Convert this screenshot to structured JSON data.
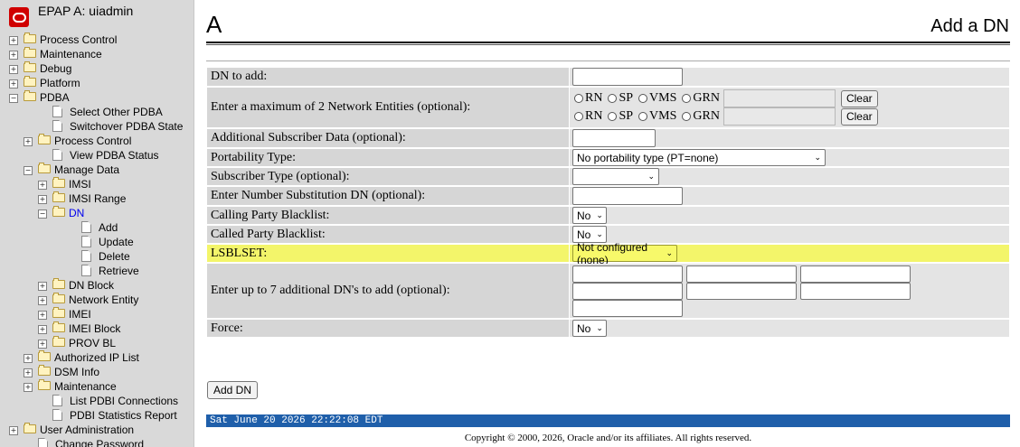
{
  "app": {
    "title": "EPAP A: uiadmin"
  },
  "sidebar": {
    "items": [
      {
        "label": "Process Control",
        "type": "folder",
        "toggle": "+",
        "open": false,
        "level": 0,
        "active": false
      },
      {
        "label": "Maintenance",
        "type": "folder",
        "toggle": "+",
        "open": false,
        "level": 0,
        "active": false
      },
      {
        "label": "Debug",
        "type": "folder",
        "toggle": "+",
        "open": false,
        "level": 0,
        "active": false
      },
      {
        "label": "Platform",
        "type": "folder",
        "toggle": "+",
        "open": false,
        "level": 0,
        "active": false
      },
      {
        "label": "PDBA",
        "type": "folder",
        "toggle": "−",
        "open": true,
        "level": 0,
        "active": false
      },
      {
        "label": "Select Other PDBA",
        "type": "doc",
        "toggle": "",
        "open": false,
        "level": 1,
        "active": false
      },
      {
        "label": "Switchover PDBA State",
        "type": "doc",
        "toggle": "",
        "open": false,
        "level": 1,
        "active": false
      },
      {
        "label": "Process Control",
        "type": "folder",
        "toggle": "+",
        "open": false,
        "level": 1,
        "active": false
      },
      {
        "label": "View PDBA Status",
        "type": "doc",
        "toggle": "",
        "open": false,
        "level": 1,
        "active": false
      },
      {
        "label": "Manage Data",
        "type": "folder",
        "toggle": "−",
        "open": true,
        "level": 1,
        "active": false
      },
      {
        "label": "IMSI",
        "type": "folder",
        "toggle": "+",
        "open": false,
        "level": 2,
        "active": false
      },
      {
        "label": "IMSI Range",
        "type": "folder",
        "toggle": "+",
        "open": false,
        "level": 2,
        "active": false
      },
      {
        "label": "DN",
        "type": "folder",
        "toggle": "−",
        "open": true,
        "level": 2,
        "active": true
      },
      {
        "label": "Add",
        "type": "doc",
        "toggle": "",
        "open": false,
        "level": 3,
        "active": false
      },
      {
        "label": "Update",
        "type": "doc",
        "toggle": "",
        "open": false,
        "level": 3,
        "active": false
      },
      {
        "label": "Delete",
        "type": "doc",
        "toggle": "",
        "open": false,
        "level": 3,
        "active": false
      },
      {
        "label": "Retrieve",
        "type": "doc",
        "toggle": "",
        "open": false,
        "level": 3,
        "active": false
      },
      {
        "label": "DN Block",
        "type": "folder",
        "toggle": "+",
        "open": false,
        "level": 2,
        "active": false
      },
      {
        "label": "Network Entity",
        "type": "folder",
        "toggle": "+",
        "open": false,
        "level": 2,
        "active": false
      },
      {
        "label": "IMEI",
        "type": "folder",
        "toggle": "+",
        "open": false,
        "level": 2,
        "active": false
      },
      {
        "label": "IMEI Block",
        "type": "folder",
        "toggle": "+",
        "open": false,
        "level": 2,
        "active": false
      },
      {
        "label": "PROV BL",
        "type": "folder",
        "toggle": "+",
        "open": false,
        "level": 2,
        "active": false
      },
      {
        "label": "Authorized IP List",
        "type": "folder",
        "toggle": "+",
        "open": false,
        "level": 1,
        "active": false
      },
      {
        "label": "DSM Info",
        "type": "folder",
        "toggle": "+",
        "open": false,
        "level": 1,
        "active": false
      },
      {
        "label": "Maintenance",
        "type": "folder",
        "toggle": "+",
        "open": false,
        "level": 1,
        "active": false
      },
      {
        "label": "List PDBI Connections",
        "type": "doc",
        "toggle": "",
        "open": false,
        "level": 1,
        "active": false
      },
      {
        "label": "PDBI Statistics Report",
        "type": "doc",
        "toggle": "",
        "open": false,
        "level": 1,
        "active": false
      },
      {
        "label": "User Administration",
        "type": "folder",
        "toggle": "+",
        "open": false,
        "level": 0,
        "active": false
      },
      {
        "label": "Change Password",
        "type": "doc",
        "toggle": "",
        "open": false,
        "level": 0,
        "active": false
      }
    ]
  },
  "page": {
    "letter": "A",
    "title": "Add a DN"
  },
  "form": {
    "dn_to_add": {
      "label": "DN to add:",
      "value": ""
    },
    "network_entities": {
      "label": "Enter a maximum of 2 Network Entities (optional):",
      "options": [
        "RN",
        "SP",
        "VMS",
        "GRN"
      ],
      "clear_label": "Clear"
    },
    "additional_subscriber_data": {
      "label": "Additional Subscriber Data (optional):",
      "value": ""
    },
    "portability_type": {
      "label": "Portability Type:",
      "value": "No portability type (PT=none)"
    },
    "subscriber_type": {
      "label": "Subscriber Type (optional):",
      "value": ""
    },
    "number_substitution": {
      "label": "Enter Number Substitution DN (optional):",
      "value": ""
    },
    "calling_party_blacklist": {
      "label": "Calling Party Blacklist:",
      "value": "No"
    },
    "called_party_blacklist": {
      "label": "Called Party Blacklist:",
      "value": "No"
    },
    "lsblset": {
      "label": "LSBLSET:",
      "value": "Not configured (none)"
    },
    "additional_dns": {
      "label": "Enter up to 7 additional DN's to add (optional):"
    },
    "force": {
      "label": "Force:",
      "value": "No"
    }
  },
  "actions": {
    "add_dn_label": "Add DN"
  },
  "status": {
    "datetime": "Sat June 20 2026 22:22:08 EDT"
  },
  "footer": {
    "copyright": "Copyright © 2000, 2026, Oracle and/or its affiliates. All rights reserved."
  },
  "colors": {
    "highlight": "#f3f56a",
    "status_bar": "#1f5faa",
    "active_link": "#0000ee",
    "logo": "#d00000"
  }
}
